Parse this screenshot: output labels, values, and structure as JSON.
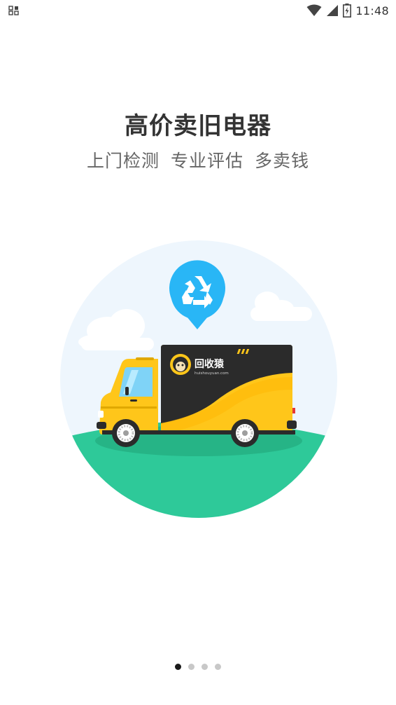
{
  "status_bar": {
    "time": "11:48"
  },
  "title": "高价卖旧电器",
  "subtitle": {
    "items": [
      "上门检测",
      "专业评估",
      "多卖钱"
    ]
  },
  "illustration": {
    "brand_name": "回收猿",
    "brand_url": "huishouyuan.com",
    "icon": "recycle-icon",
    "colors": {
      "pin": "#29b6f6",
      "truck_yellow": "#ffc61a",
      "truck_dark": "#2b2b2b",
      "ground": "#2ec999",
      "sky": "#eef6fd"
    }
  },
  "pager": {
    "count": 4,
    "active_index": 0
  }
}
